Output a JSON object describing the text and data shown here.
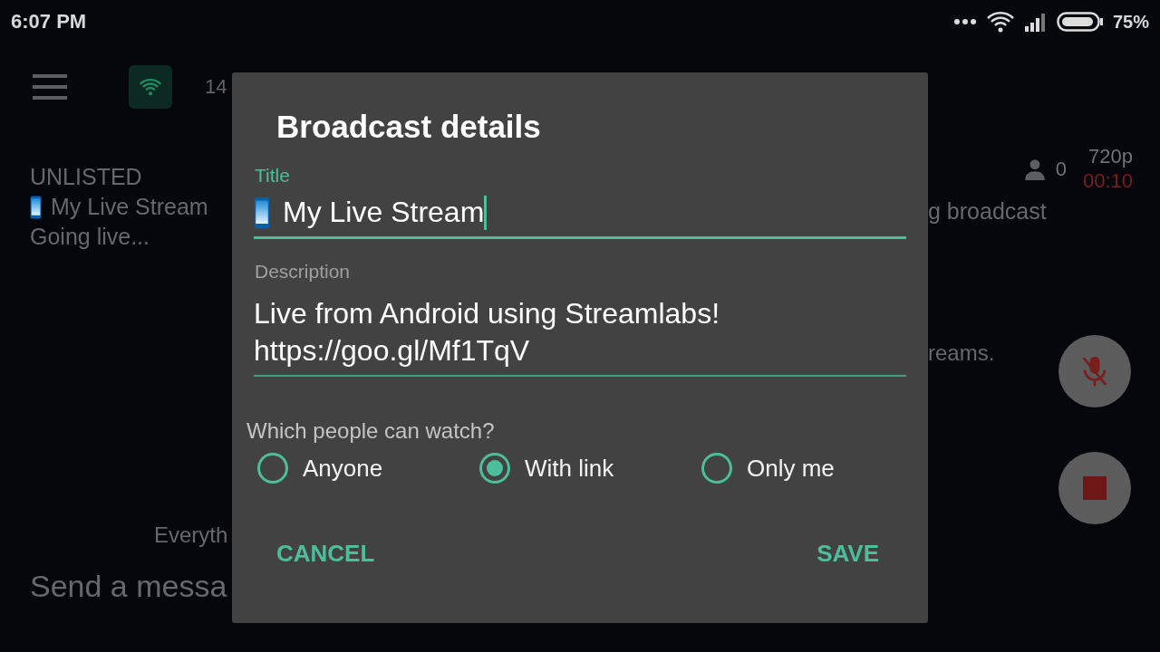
{
  "status_bar": {
    "time": "6:07 PM",
    "battery": "75%"
  },
  "toolbar": {
    "count": "14"
  },
  "stream": {
    "privacy": "UNLISTED",
    "title": "My Live Stream",
    "status": "Going live...",
    "viewers": "0",
    "resolution": "720p",
    "elapsed": "00:10",
    "message": "g broadcast"
  },
  "chat": {
    "notice_left": "Everyth",
    "notice_right": "reams.",
    "input_placeholder": "Send a messa"
  },
  "dialog": {
    "title": "Broadcast details",
    "fields": [
      {
        "kind": "title",
        "label": "Title",
        "value": "My Live Stream",
        "focused": true
      },
      {
        "kind": "text",
        "label": "Description",
        "value": "Live from Android using Streamlabs! https://goo.gl/Mf1TqV",
        "focused": false
      }
    ],
    "question": "Which people can watch?",
    "options": [
      {
        "label": "Anyone",
        "selected": false
      },
      {
        "label": "With link",
        "selected": true
      },
      {
        "label": "Only me",
        "selected": false
      }
    ],
    "buttons": [
      "CANCEL",
      "SAVE"
    ]
  }
}
